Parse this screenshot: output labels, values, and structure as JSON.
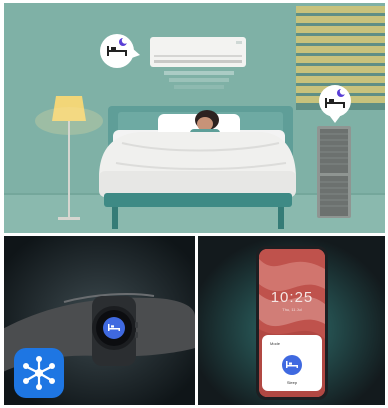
{
  "scene": {
    "bedroom": {
      "colors": {
        "wall": "#7fb1a6",
        "floor": "#8ab7ad",
        "sheet": "#ececec",
        "bed_frame": "#3f8a86",
        "blinds": "#c6c27a"
      },
      "icons": [
        "sleep-bed-icon",
        "sleep-moon-icon"
      ]
    },
    "watch": {
      "icon": "sleep-bed-icon",
      "accent": "#3f69e0"
    },
    "phone": {
      "lock_time": "10:25",
      "lock_date": "Thu, 11 Jul",
      "card_title": "Mode",
      "mode_label": "Sleep",
      "accent": "#3f69e0"
    },
    "app_logo": {
      "icon": "smartthings-logo-icon",
      "color": "#1e76e3"
    }
  }
}
